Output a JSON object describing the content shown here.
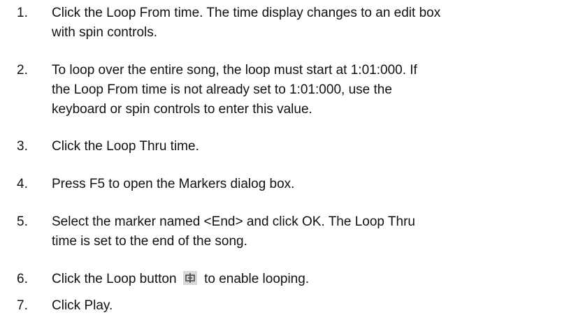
{
  "steps": [
    {
      "number": "1.",
      "lines": [
        "Click the Loop From time. The time display changes to an edit box",
        "with spin controls."
      ]
    },
    {
      "number": "2.",
      "lines": [
        "To loop over the entire song, the loop must start at 1:01:000. If",
        "the Loop From time is not already set to 1:01:000, use the",
        "keyboard or spin controls to enter this value."
      ]
    },
    {
      "number": "3.",
      "lines": [
        "Click the Loop Thru time."
      ]
    },
    {
      "number": "4.",
      "lines": [
        "Press F5 to open the Markers dialog box."
      ]
    },
    {
      "number": "5.",
      "lines": [
        "Select the marker named <End> and click OK. The Loop Thru",
        "time is set to the end of the song."
      ]
    },
    {
      "number": "6.",
      "before_icon": "Click the Loop button",
      "after_icon": "to enable looping.",
      "icon": "loop-icon"
    },
    {
      "number": "7.",
      "lines": [
        "Click Play."
      ]
    }
  ],
  "colors": {
    "text": "#111111",
    "icon_background": "#d8d8d8",
    "icon_glyph": "#4a4a4a"
  }
}
